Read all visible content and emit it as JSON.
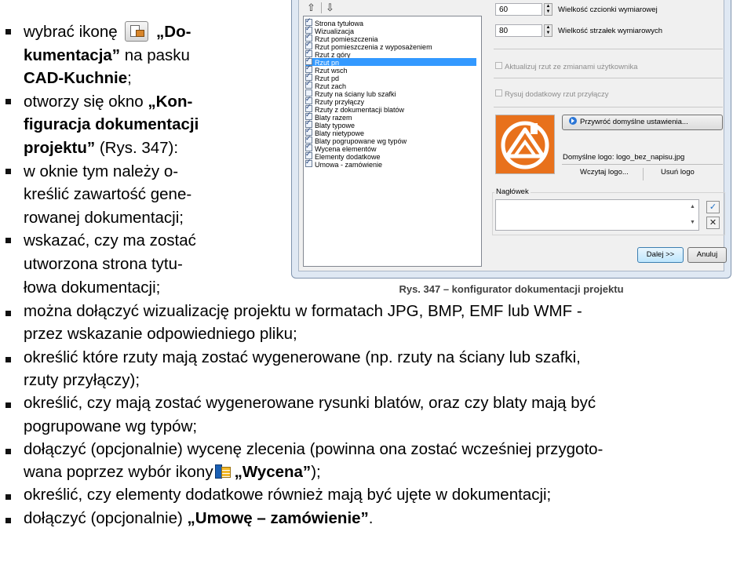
{
  "left_bullets": [
    {
      "parts": [
        {
          "t": "wybrać ikonę "
        },
        {
          "icon": "cad-docs-icon"
        },
        {
          "t": " „Do-",
          "b": true
        }
      ]
    },
    {
      "parts": [
        {
          "t": "kumentacja”",
          "b": true
        },
        {
          "t": " na pasku"
        }
      ],
      "cont": true
    },
    {
      "parts": [
        {
          "t": "CAD-Kuchnie",
          "b": true
        },
        {
          "t": ";"
        }
      ],
      "cont": true
    },
    {
      "parts": [
        {
          "t": "otworzy się okno "
        },
        {
          "t": "„Kon-",
          "b": true
        }
      ]
    },
    {
      "parts": [
        {
          "t": "figuracja dokumentacji",
          "b": true
        }
      ],
      "cont": true
    },
    {
      "parts": [
        {
          "t": "projektu”",
          "b": true
        },
        {
          "t": " (Rys. 347):"
        }
      ],
      "cont": true
    },
    {
      "parts": [
        {
          "t": "w oknie tym należy o-"
        }
      ]
    },
    {
      "parts": [
        {
          "t": "kreślić zawartość gene-"
        }
      ],
      "cont": true
    },
    {
      "parts": [
        {
          "t": "rowanej dokumentacji;"
        }
      ],
      "cont": true
    },
    {
      "parts": [
        {
          "t": "wskazać, czy ma zostać"
        }
      ]
    },
    {
      "parts": [
        {
          "t": "utworzona strona tytu-"
        }
      ],
      "cont": true
    },
    {
      "parts": [
        {
          "t": "łowa dokumentacji;"
        }
      ],
      "cont": true
    }
  ],
  "dialog": {
    "toolbar": {
      "up_glyph": "⇧",
      "down_glyph": "⇩"
    },
    "list_items": [
      {
        "label": "Strona tytułowa",
        "checked": true
      },
      {
        "label": "Wizualizacja",
        "checked": true
      },
      {
        "label": "Rzut pomieszczenia",
        "checked": true
      },
      {
        "label": "Rzut pomieszczenia z wyposażeniem",
        "checked": true
      },
      {
        "label": "Rzut z góry",
        "checked": true
      },
      {
        "label": "Rzut pn",
        "checked": true,
        "selected": true
      },
      {
        "label": "Rzut wsch",
        "checked": true
      },
      {
        "label": "Rzut pd",
        "checked": true
      },
      {
        "label": "Rzut zach",
        "checked": true
      },
      {
        "label": "Rzuty na ściany lub szafki",
        "checked": false
      },
      {
        "label": "Rzuty przyłączy",
        "checked": true
      },
      {
        "label": "Rzuty z dokumentacji blatów",
        "checked": true
      },
      {
        "label": "Blaty razem",
        "checked": true
      },
      {
        "label": "Blaty typowe",
        "checked": true
      },
      {
        "label": "Blaty nietypowe",
        "checked": true
      },
      {
        "label": "Blaty pogrupowane wg typów",
        "checked": true
      },
      {
        "label": "Wycena elementów",
        "checked": true
      },
      {
        "label": "Elementy dodatkowe",
        "checked": true
      },
      {
        "label": "Umowa - zamówienie",
        "checked": true
      }
    ],
    "font_size_value": "60",
    "font_size_label": "Wielkość czcionki wymiarowej",
    "arrow_size_value": "80",
    "arrow_size_label": "Wielkość strzałek wymiarowych",
    "update_view_label": "Aktualizuj rzut ze zmianami użytkownika",
    "extra_view_label": "Rysuj dodatkowy rzut przyłączy",
    "restore_defaults_label": "Przywróć domyślne ustawienia...",
    "default_logo_label": "Domyślne logo:",
    "default_logo_file": "logo_bez_napisu.jpg",
    "load_logo_label": "Wczytaj logo...",
    "remove_logo_label": "Usuń logo",
    "header_label": "Nagłówek",
    "next_label": "Dalej >>",
    "cancel_label": "Anuluj",
    "logo_colors": {
      "orange": "#e8711c",
      "white": "#ffffff"
    }
  },
  "caption": "Rys. 347 – konfigurator dokumentacji projektu",
  "bottom_bullets": [
    {
      "parts": [
        {
          "t": "można dołączyć wizualizację projektu w formatach JPG, BMP, EMF lub WMF -"
        }
      ]
    },
    {
      "parts": [
        {
          "t": "przez wskazanie odpowiedniego pliku;"
        }
      ],
      "cont": true
    },
    {
      "parts": [
        {
          "t": "określić które rzuty mają zostać wygenerowane (np. rzuty na ściany lub szafki,"
        }
      ]
    },
    {
      "parts": [
        {
          "t": "rzuty przyłączy);"
        }
      ],
      "cont": true
    },
    {
      "parts": [
        {
          "t": "określić, czy mają zostać wygenerowane rysunki blatów, oraz czy blaty mają być"
        }
      ]
    },
    {
      "parts": [
        {
          "t": "pogrupowane wg typów;"
        }
      ],
      "cont": true
    },
    {
      "parts": [
        {
          "t": "dołączyć (opcjonalnie) wycenę zlecenia (powinna ona zostać wcześniej przygoto-"
        }
      ]
    },
    {
      "parts": [
        {
          "t": "wana poprzez wybór ikony"
        },
        {
          "icon": "wycena-icon"
        },
        {
          "t": "„Wycena”",
          "b": true
        },
        {
          "t": ");"
        }
      ],
      "cont": true
    },
    {
      "parts": [
        {
          "t": "określić, czy elementy dodatkowe również mają być ujęte w dokumentacji;"
        }
      ]
    },
    {
      "parts": [
        {
          "t": "dołączyć (opcjonalnie) "
        },
        {
          "t": "„Umowę – zamówienie”",
          "b": true
        },
        {
          "t": "."
        }
      ]
    }
  ]
}
